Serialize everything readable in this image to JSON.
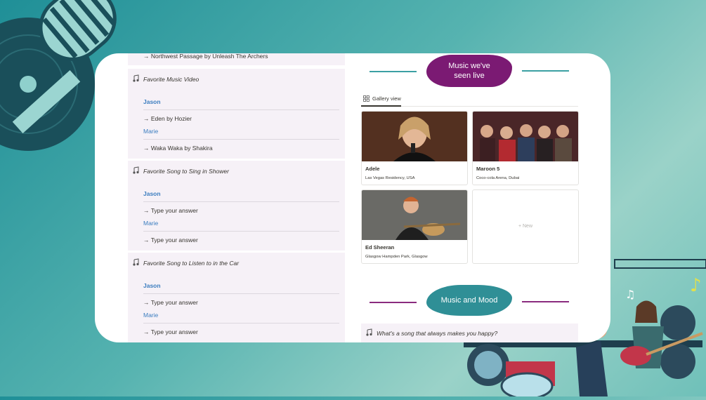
{
  "left": {
    "top_answer": "→ Northwest Passage by Unleash The Archers",
    "questions": [
      {
        "title": "Favorite Music Video",
        "person1": "Jason",
        "answer1": "→ Eden by Hozier",
        "person2": "Marie",
        "answer2": "→ Waka Waka by Shakira"
      },
      {
        "title": "Favorite Song to Sing in Shower",
        "person1": "Jason",
        "answer1": "→ Type your answer",
        "person2": "Marie",
        "answer2": "→ Type your answer"
      },
      {
        "title": "Favorite Song to Listen to in the Car",
        "person1": "Jason",
        "answer1": "→ Type your answer",
        "person2": "Marie",
        "answer2": "→ Type your answer"
      }
    ]
  },
  "right": {
    "live_heading_line1": "Music we've",
    "live_heading_line2": "seen live",
    "gallery_tab": "Gallery view",
    "gallery": [
      {
        "name": "Adele",
        "location": "Las Vegas Residency, USA"
      },
      {
        "name": "Maroon 5",
        "location": "Coco-cola Arena, Dubai"
      },
      {
        "name": "Ed Sheeran",
        "location": "Glasgow Hampden Park, Glasgow"
      }
    ],
    "new_label": "+ New",
    "mood_heading": "Music and Mood",
    "mood_question": "What's a song that always makes you happy?"
  },
  "colors": {
    "purple_pill": "#7b1a73",
    "teal_pill": "#2f8f96",
    "link_blue": "#3b7dbf"
  }
}
